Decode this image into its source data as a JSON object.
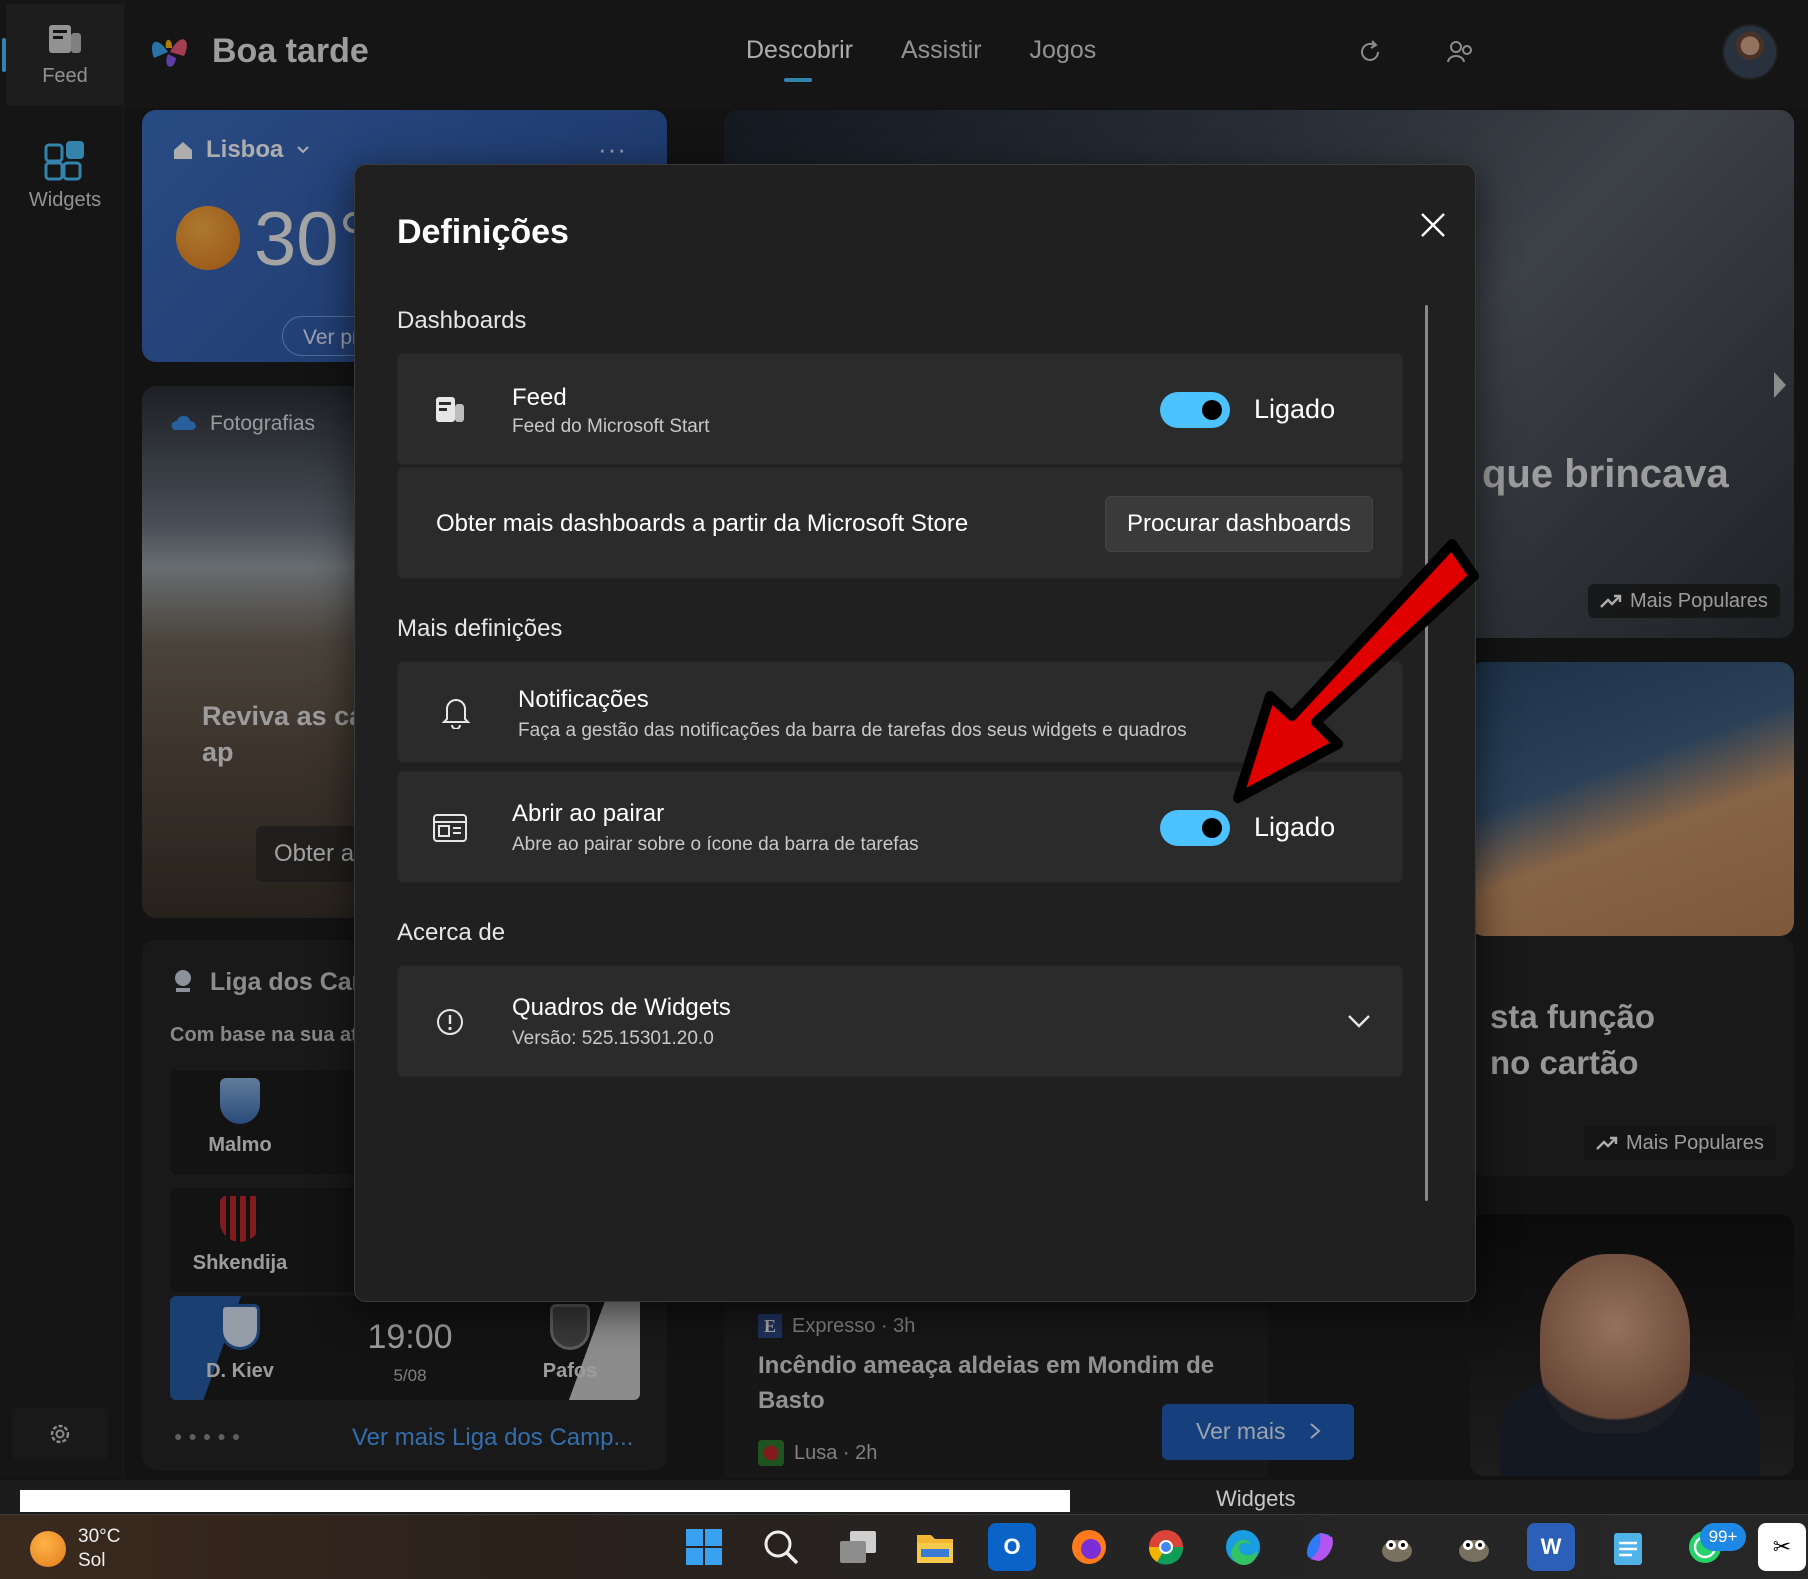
{
  "rail": {
    "items": [
      {
        "label": "Feed",
        "icon": "feed-icon"
      },
      {
        "label": "Widgets",
        "icon": "widgets-icon"
      }
    ],
    "settings_icon": "gear-icon"
  },
  "header": {
    "greeting": "Boa tarde",
    "tabs": [
      {
        "label": "Descobrir",
        "active": true
      },
      {
        "label": "Assistir",
        "active": false
      },
      {
        "label": "Jogos",
        "active": false
      }
    ],
    "accent": "#4cc2ff"
  },
  "weather": {
    "location": "Lisboa",
    "more": "···",
    "temp": "30°",
    "pill": "Ver pr"
  },
  "photos": {
    "label": "Fotografias",
    "text": "Reviva as carregar as partir da ap",
    "button": "Obter a"
  },
  "league": {
    "title": "Liga dos Cam",
    "subtitle": "Com base na sua at",
    "matches": [
      {
        "home": "Malmo",
        "away": "",
        "time": "",
        "date": ""
      },
      {
        "home": "Shkendija",
        "away": "",
        "time": "",
        "date": ""
      },
      {
        "home": "D. Kiev",
        "away": "Pafos",
        "time": "19:00",
        "date": "5/08"
      }
    ],
    "more_link": "Ver mais Liga dos Camp..."
  },
  "feed": {
    "hero_title": "que brincava",
    "popular_label": "Mais Populares",
    "card2_text_line1": "sta função",
    "card2_text_line2": "no cartão",
    "news": {
      "source": "Expresso · 3h",
      "source_logo": "E",
      "title": "Incêndio ameaça aldeias em Mondim de Basto",
      "source2": "Lusa · 2h"
    },
    "ver_mais": "Ver mais",
    "widgets_label": "Widgets"
  },
  "dialog": {
    "title": "Definições",
    "sections": {
      "dashboards": "Dashboards",
      "more": "Mais definições",
      "about": "Acerca de"
    },
    "feed_row": {
      "title": "Feed",
      "subtitle": "Feed do Microsoft Start",
      "toggle_state": "Ligado",
      "toggle_on": true
    },
    "store_row": {
      "text": "Obter mais dashboards a partir da Microsoft Store",
      "button": "Procurar dashboards"
    },
    "notifications_row": {
      "title": "Notificações",
      "subtitle": "Faça a gestão das notificações da barra de tarefas dos seus widgets e quadros"
    },
    "hover_row": {
      "title": "Abrir ao pairar",
      "subtitle": "Abre ao pairar sobre o ícone da barra de tarefas",
      "toggle_state": "Ligado",
      "toggle_on": true
    },
    "about_row": {
      "title": "Quadros de Widgets",
      "subtitle": "Versão: 525.15301.20.0"
    }
  },
  "taskbar": {
    "weather_temp": "30°C",
    "weather_desc": "Sol",
    "badge": "99+",
    "apps": [
      "start-icon",
      "search-icon",
      "task-view-icon",
      "file-explorer-icon",
      "outlook-icon",
      "firefox-icon",
      "chrome-icon",
      "edge-icon",
      "copilot-icon",
      "gimp-icon",
      "gimp-icon",
      "word-icon",
      "notepad-icon",
      "whatsapp-icon",
      "capcut-icon"
    ]
  },
  "annotation_color": "#e00000"
}
